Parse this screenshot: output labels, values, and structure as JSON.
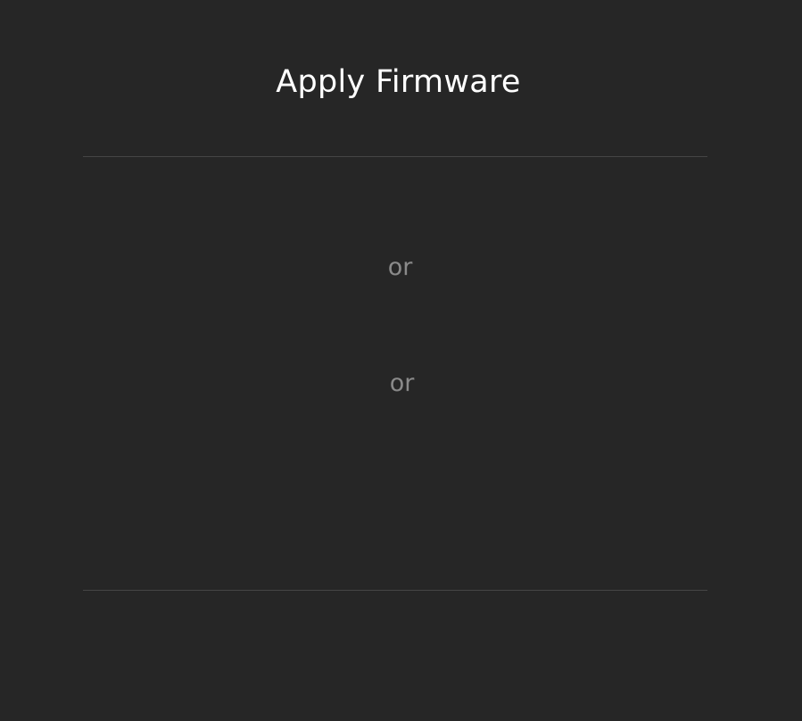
{
  "dialog": {
    "title": "Apply Firmware",
    "separators": [
      "or",
      "or"
    ]
  },
  "colors": {
    "background": "#262626",
    "title_text": "#ffffff",
    "separator_text": "#8a8a8a",
    "divider": "#454545"
  }
}
